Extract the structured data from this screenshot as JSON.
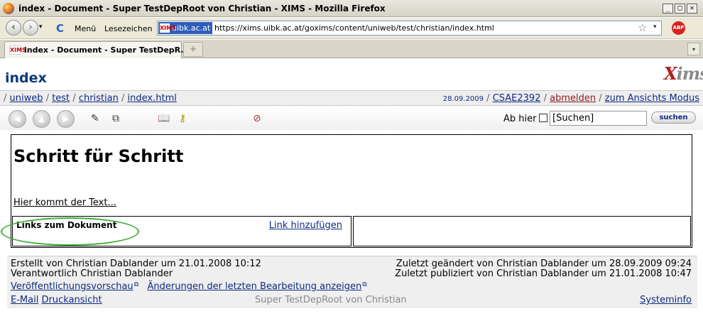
{
  "browser": {
    "window_title": "index - Document - Super TestDepRoot von Christian - XIMS - Mozilla Firefox",
    "menu_items": [
      "Menü",
      "Lesezeichen"
    ],
    "site_label": "uibk.ac.at",
    "url": "https://xims.uibk.ac.at/goxims/content/uniweb/test/christian/index.html",
    "favicon_text": "XIMS",
    "abp_label": "ABP",
    "tab_label": "index - Document - Super TestDepR...",
    "new_tab_symbol": "+",
    "window_buttons": [
      "_",
      "□",
      "✕"
    ],
    "nav_symbols": [
      "‹",
      "›",
      "▾"
    ],
    "reload_symbol": "C"
  },
  "page": {
    "title": "index",
    "logo_text_1": "X",
    "logo_text_2": "ims",
    "breadcrumbs": {
      "sep": "/",
      "items": [
        "uniweb",
        "test",
        "christian",
        "index.html"
      ]
    },
    "userbar": {
      "date": "28.09.2009",
      "user": "CSAE2392",
      "logout": "abmelden",
      "view_mode": "zum Ansichts Modus"
    },
    "toolbar": {
      "abhier_label": "Ab hier",
      "search_value": "[Suchen]",
      "search_button": "suchen",
      "icons": [
        "back-icon",
        "up-icon",
        "forward-icon",
        "edit-icon",
        "copy-icon",
        "publish-icon",
        "move-icon",
        "delete-icon"
      ]
    },
    "content": {
      "heading": "Schritt für Schritt",
      "body_text": "Hier kommt der Text...",
      "links_title": "Links zum Dokument",
      "add_link": "Link hinzufügen"
    },
    "footer": {
      "created": "Erstellt von Christian Dablander um 21.01.2008 10:12",
      "responsible": "Verantwortlich Christian Dablander",
      "modified": "Zuletzt geändert von Christian Dablander um 28.09.2009 09:24",
      "published": "Zuletzt publiziert von Christian Dablander um 21.01.2008 10:47",
      "preview_link": "Veröffentlichungsvorschau",
      "changes_link": "Änderungen der letzten Bearbeitung anzeigen",
      "email_link": "E-Mail",
      "print_link": "Druckansicht",
      "owner": "Super TestDepRoot von Christian",
      "sysinfo_link": "Systeminfo"
    }
  },
  "colors": {
    "accent_blue": "#0e2a80",
    "highlight_green": "#3fae36",
    "logout_red": "#8a1a1a"
  }
}
